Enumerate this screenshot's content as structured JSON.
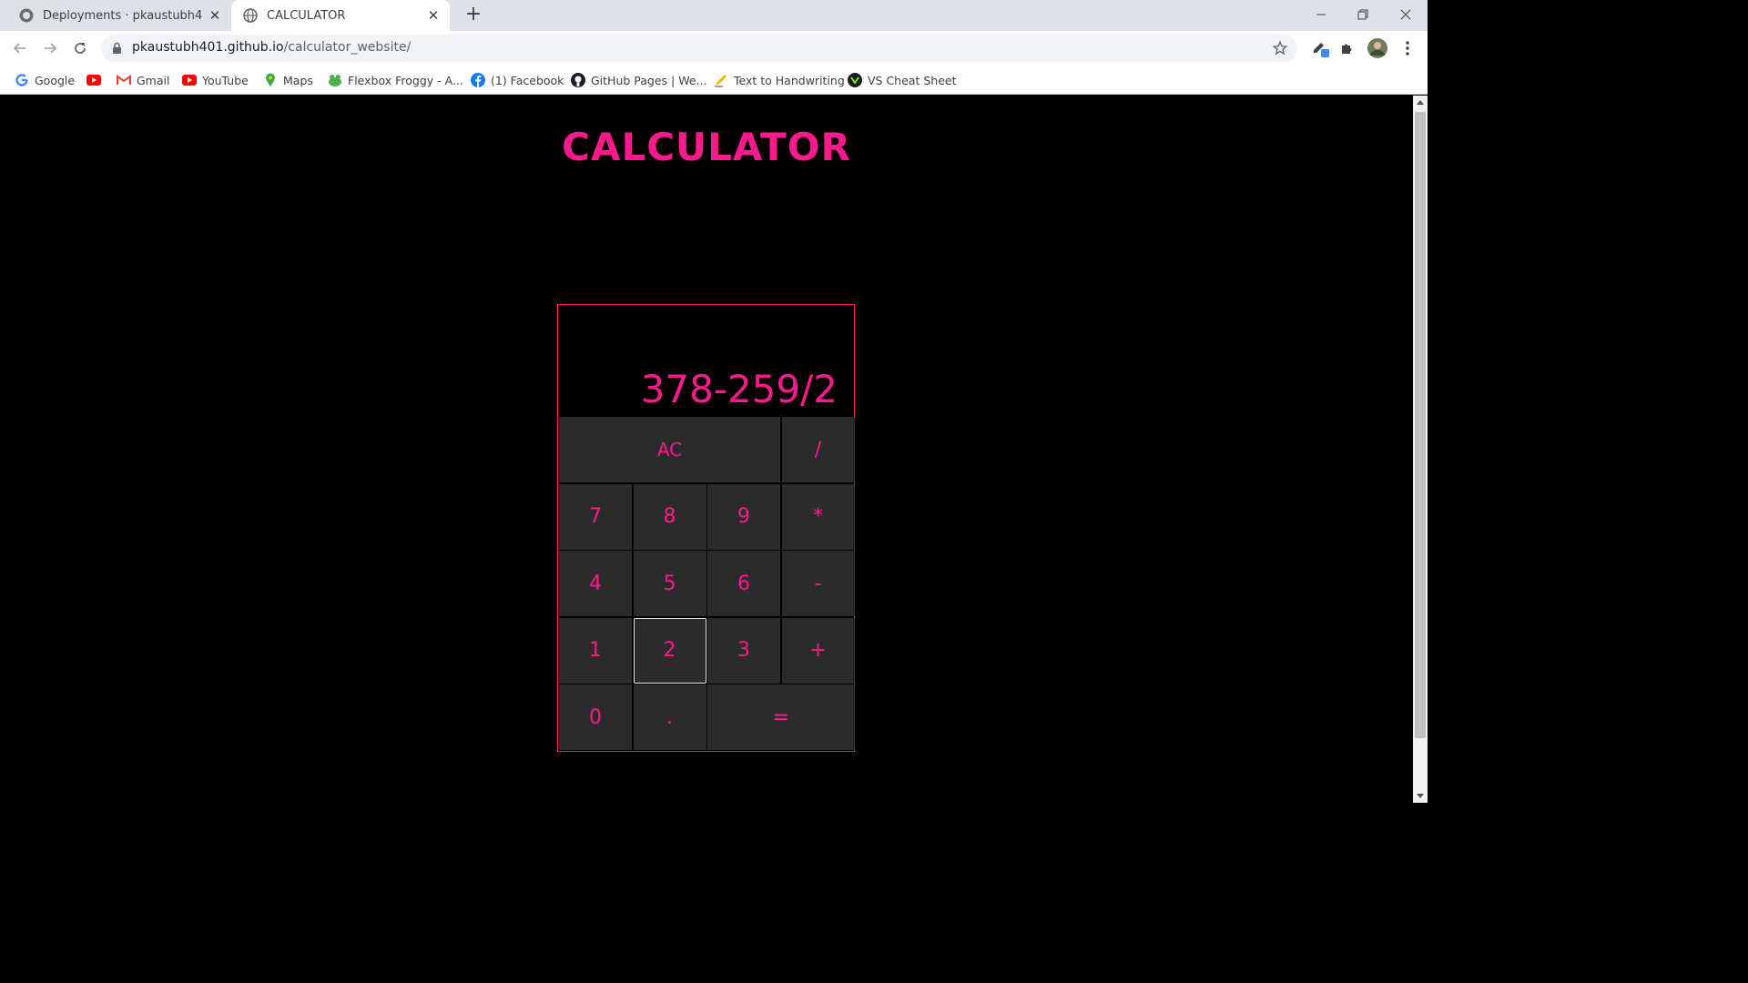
{
  "browser": {
    "tabs": [
      {
        "title": "Deployments · pkaustubh401/cal",
        "icon": "github-icon",
        "active": false
      },
      {
        "title": "CALCULATOR",
        "icon": "globe-icon",
        "active": true
      }
    ],
    "url_host": "pkaustubh401.github.io",
    "url_path": "/calculator_website/",
    "bookmarks": [
      {
        "label": "Google",
        "icon": "google-icon"
      },
      {
        "label": "",
        "icon": "youtube-icon"
      },
      {
        "label": "Gmail",
        "icon": "gmail-icon"
      },
      {
        "label": "YouTube",
        "icon": "youtube-icon"
      },
      {
        "label": "Maps",
        "icon": "maps-icon"
      },
      {
        "label": "Flexbox Froggy - A...",
        "icon": "frog-icon"
      },
      {
        "label": "(1) Facebook",
        "icon": "facebook-icon"
      },
      {
        "label": "GitHub Pages | We...",
        "icon": "github-icon"
      },
      {
        "label": "Text to Handwriting",
        "icon": "pen-icon"
      },
      {
        "label": "VS Cheat Sheet",
        "icon": "vs-icon"
      }
    ]
  },
  "page": {
    "title": "CALCULATOR",
    "accent_color": "#ff1a8c",
    "background_color": "#000000",
    "key_color": "#2b2b2b"
  },
  "calculator": {
    "display": "378-259/2",
    "keys": [
      {
        "label": "AC",
        "name": "key-clear",
        "cls": "ac"
      },
      {
        "label": "/",
        "name": "key-divide",
        "cls": ""
      },
      {
        "label": "7",
        "name": "key-7",
        "cls": ""
      },
      {
        "label": "8",
        "name": "key-8",
        "cls": ""
      },
      {
        "label": "9",
        "name": "key-9",
        "cls": ""
      },
      {
        "label": "*",
        "name": "key-multiply",
        "cls": ""
      },
      {
        "label": "4",
        "name": "key-4",
        "cls": ""
      },
      {
        "label": "5",
        "name": "key-5",
        "cls": ""
      },
      {
        "label": "6",
        "name": "key-6",
        "cls": ""
      },
      {
        "label": "-",
        "name": "key-subtract",
        "cls": ""
      },
      {
        "label": "1",
        "name": "key-1",
        "cls": ""
      },
      {
        "label": "2",
        "name": "key-2",
        "cls": "focused"
      },
      {
        "label": "3",
        "name": "key-3",
        "cls": ""
      },
      {
        "label": "+",
        "name": "key-add",
        "cls": ""
      },
      {
        "label": "0",
        "name": "key-0",
        "cls": ""
      },
      {
        "label": ".",
        "name": "key-decimal",
        "cls": ""
      },
      {
        "label": "=",
        "name": "key-equals",
        "cls": "eq"
      }
    ]
  }
}
